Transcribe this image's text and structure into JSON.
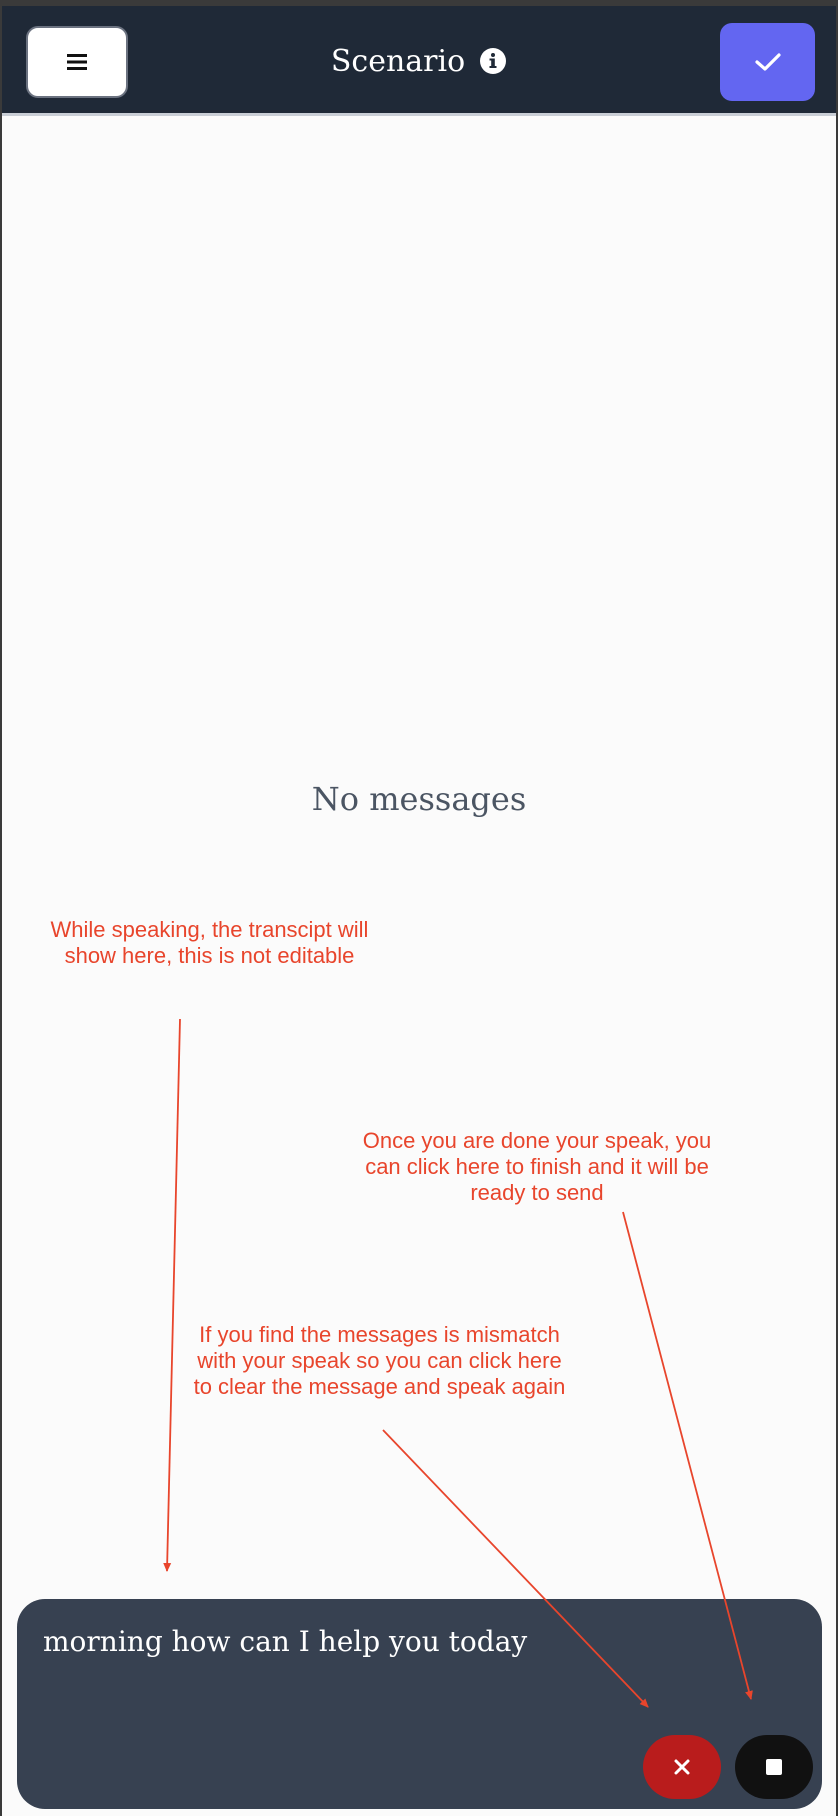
{
  "header": {
    "title": "Scenario",
    "menu_icon": "hamburger-icon",
    "info_icon": "info-icon",
    "confirm_icon": "check-icon"
  },
  "main": {
    "empty_state": "No messages"
  },
  "annotations": {
    "transcript_note": "While speaking, the transcipt will show here, this is not editable",
    "finish_note": "Once you are done your speak, you can click here to finish and it will be ready to send",
    "clear_note": "If you find the messages is mismatch with your speak so you can click here to clear the message and speak again"
  },
  "composer": {
    "transcript": "morning how can I help you today",
    "clear_icon": "close-icon",
    "stop_icon": "stop-icon"
  },
  "colors": {
    "header_bg": "#1f2937",
    "accent": "#6366f1",
    "annotation": "#e8452c",
    "composer_bg": "#374151",
    "clear_bg": "#b91c1c",
    "stop_bg": "#111111"
  }
}
